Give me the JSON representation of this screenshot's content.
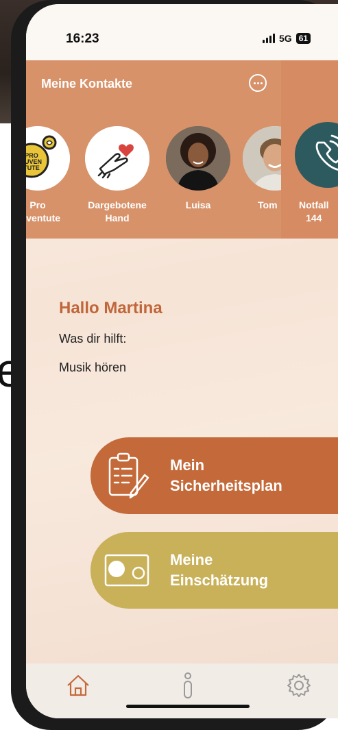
{
  "status": {
    "time": "16:23",
    "network": "5G",
    "battery": "61"
  },
  "contacts": {
    "title": "Meine Kontakte",
    "items": [
      {
        "name_line1": "Pro",
        "name_line2": "Juventute"
      },
      {
        "name_line1": "Dargebotene",
        "name_line2": "Hand"
      },
      {
        "name_line1": "Luisa",
        "name_line2": ""
      },
      {
        "name_line1": "Tom",
        "name_line2": ""
      }
    ],
    "logo_text": "PRO JUVENTUTE"
  },
  "emergency": {
    "line1": "Notfall",
    "line2": "144"
  },
  "main": {
    "greeting": "Hallo Martina",
    "help_label": "Was dir hilft:",
    "help_value": "Musik hören"
  },
  "actions": {
    "plan": {
      "line1": "Mein",
      "line2": "Sicherheitsplan"
    },
    "evaluation": {
      "line1": "Meine",
      "line2": "Einschätzung"
    }
  },
  "tabs": [
    "home-icon",
    "info-icon",
    "settings-icon"
  ],
  "colors": {
    "accent_orange": "#c46a3a",
    "header_peach": "#d7926a",
    "accent_mustard": "#c9b15a",
    "emergency_teal": "#2d5a5e"
  }
}
